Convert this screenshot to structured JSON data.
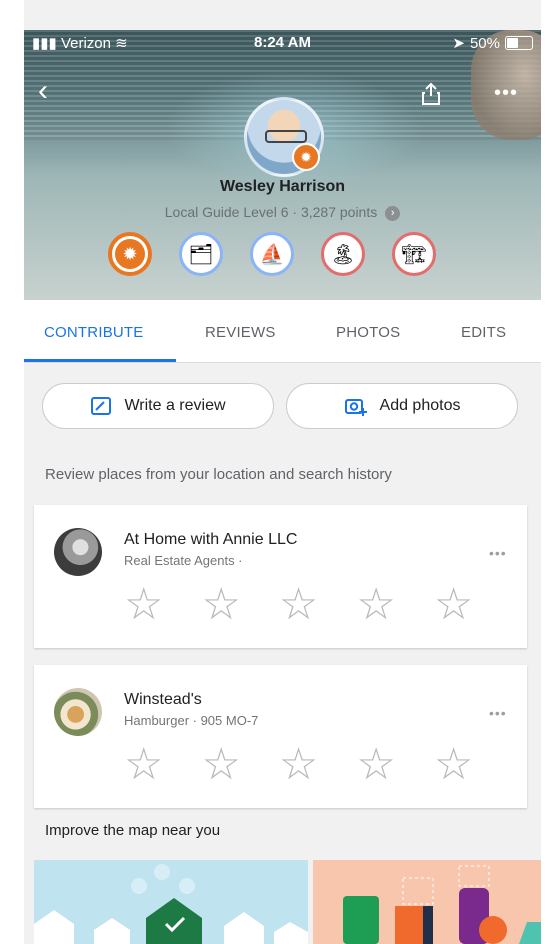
{
  "status_bar": {
    "carrier": "Verizon",
    "time": "8:24 AM",
    "battery": "50%"
  },
  "profile": {
    "name": "Wesley Harrison",
    "level_text": "Local Guide Level 6 · 3,287 points",
    "info_icon": "info-icon"
  },
  "tabs": [
    {
      "label": "CONTRIBUTE",
      "active": true
    },
    {
      "label": "REVIEWS",
      "active": false
    },
    {
      "label": "PHOTOS",
      "active": false
    },
    {
      "label": "EDITS",
      "active": false
    }
  ],
  "actions": {
    "write_review": "Write a review",
    "add_photos": "Add photos"
  },
  "review_hint": "Review places from your location and search history",
  "places": [
    {
      "title": "At Home with Annie LLC",
      "subtitle": "Real Estate Agents ·"
    },
    {
      "title": "Winstead's",
      "subtitle": "Hamburger · 905 MO-7"
    }
  ],
  "section_title": "Improve the map near you",
  "colors": {
    "accent": "#1a73e8",
    "badge_orange": "#e87722"
  }
}
